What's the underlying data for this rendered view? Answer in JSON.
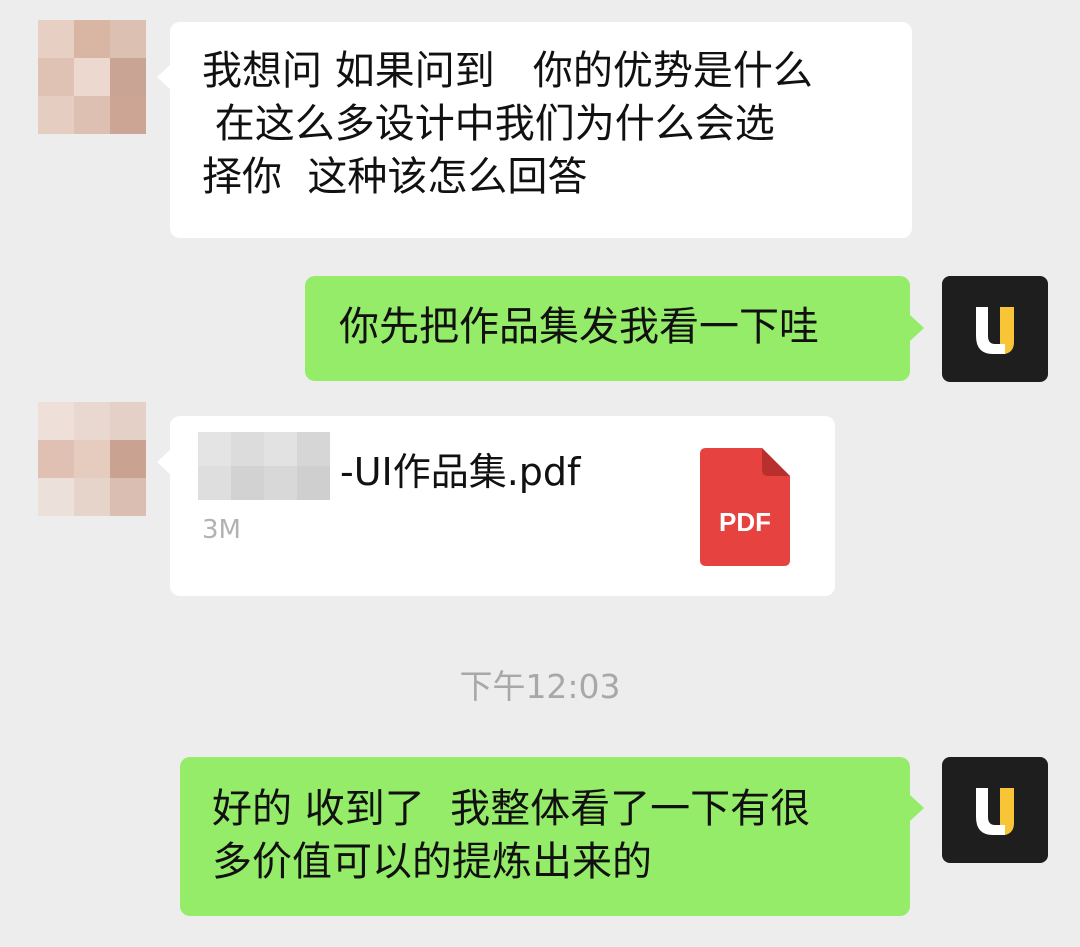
{
  "colors": {
    "background": "#ededed",
    "incoming_bubble": "#ffffff",
    "outgoing_bubble": "#95ec69",
    "timestamp": "#a8a8a8",
    "pdf_red": "#e64340"
  },
  "messages": [
    {
      "direction": "incoming",
      "type": "text",
      "text": "我想问 如果问到   你的优势是什么\n 在这么多设计中我们为什么会选\n择你  这种该怎么回答"
    },
    {
      "direction": "outgoing",
      "type": "text",
      "text": "你先把作品集发我看一下哇"
    },
    {
      "direction": "incoming",
      "type": "file",
      "file_name": "-UI作品集.pdf",
      "file_size": "3M",
      "file_icon": "pdf-icon",
      "file_icon_label": "PDF"
    },
    {
      "direction": "outgoing",
      "type": "text",
      "text": "好的 收到了  我整体看了一下有很\n多价值可以的提炼出来的"
    }
  ],
  "timestamp": "下午12:03"
}
